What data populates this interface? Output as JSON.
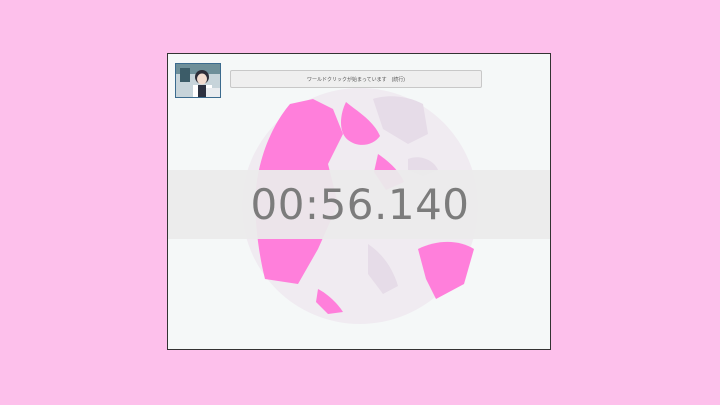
{
  "header": {
    "title": "ワールドクリックが始まっています　(続行)"
  },
  "timer": {
    "elapsed": "00:56.140"
  },
  "colors": {
    "page_background": "#fdc0eb",
    "globe_land": "#ff7fdb",
    "timer_text": "#7c7c7c"
  }
}
